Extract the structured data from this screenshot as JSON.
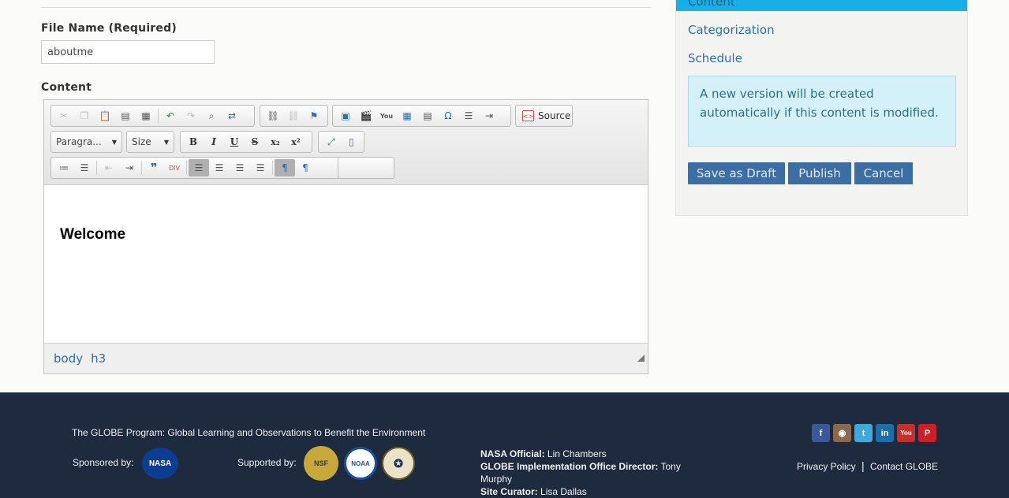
{
  "form": {
    "file_name_label": "File Name (Required)",
    "file_name_value": "aboutme",
    "content_label": "Content"
  },
  "editor": {
    "format_combo": "Paragra...",
    "size_combo": "Size",
    "source_label": "Source",
    "content_heading": "Welcome",
    "path": [
      "body",
      "h3"
    ]
  },
  "sidebar": {
    "active_item": "Content",
    "links": [
      "Categorization",
      "Schedule"
    ],
    "notice": "A new version will be created automatically if this content is modified.",
    "buttons": {
      "save_draft": "Save as Draft",
      "publish": "Publish",
      "cancel": "Cancel"
    }
  },
  "footer": {
    "tagline": "The GLOBE Program: Global Learning and Observations to Benefit the Environment",
    "sponsored_by": "Sponsored by:",
    "supported_by": "Supported by:",
    "nasa_official_label": "NASA Official:",
    "nasa_official_name": "Lin Chambers",
    "director_label": "GLOBE Implementation Office Director:",
    "director_name": "Tony Murphy",
    "curator_label": "Site Curator:",
    "curator_name": "Lisa Dallas",
    "privacy_link": "Privacy Policy",
    "contact_link": "Contact GLOBE",
    "logos": [
      "nasa-logo",
      "nsf-logo",
      "noaa-logo",
      "state-department-seal"
    ],
    "social_icons": [
      "facebook-icon",
      "instagram-icon",
      "twitter-icon",
      "linkedin-icon",
      "youtube-icon",
      "pinterest-icon"
    ]
  }
}
